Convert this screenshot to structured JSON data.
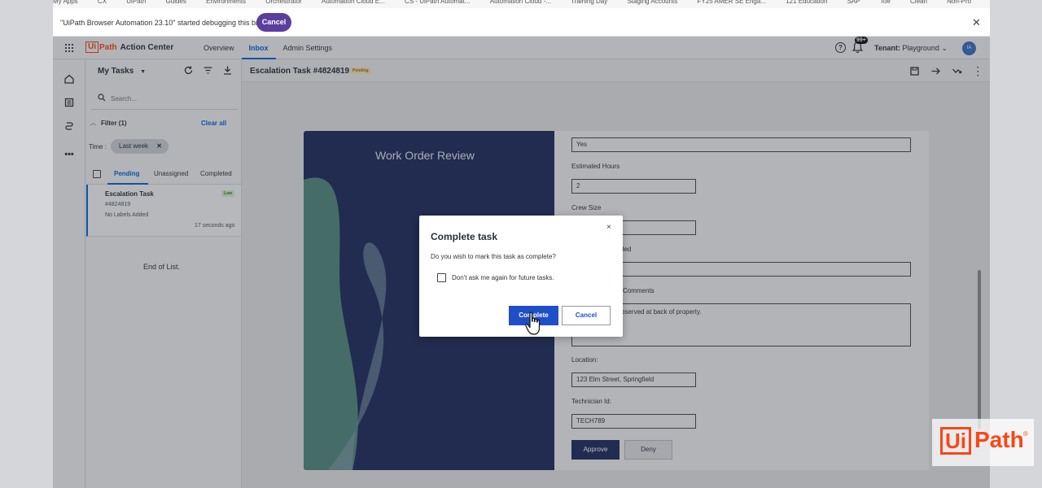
{
  "bookmarks": [
    "My Apps",
    "CX",
    "UiPath",
    "Guides",
    "Environments",
    "Orchestrator",
    "Automation Cloud E...",
    "CS - UiPath Automat...",
    "Automation Cloud -...",
    "Training Day",
    "Staging Accounts",
    "FY25 AMER SE Enga...",
    "121 Education",
    "SAP",
    "Toe",
    "Clean",
    "Non-Pro"
  ],
  "debug_bar": {
    "message": "\"UiPath Browser Automation 23.10\" started debugging this browser",
    "cancel_label": "Cancel",
    "close_glyph": "✕"
  },
  "header": {
    "logo_box": "Ui",
    "logo_path": "Path",
    "product": "Action Center",
    "nav": [
      "Overview",
      "Inbox",
      "Admin Settings"
    ],
    "active_nav": "Inbox",
    "notification_count": "99+",
    "tenant_label": "Tenant:",
    "tenant_value": "Playground",
    "avatar_initials": "IA"
  },
  "task_panel": {
    "title": "My Tasks",
    "search_placeholder": "Search...",
    "filter_label": "Filter (1)",
    "clear_all": "Clear all",
    "time_label": "Time :",
    "chip_label": "Last week",
    "chip_close": "✕",
    "tabs": [
      "Pending",
      "Unassigned",
      "Completed"
    ],
    "task": {
      "title": "Escalation Task",
      "id": "#4824819",
      "labels": "No Labels Added",
      "priority": "Low",
      "time": "17 seconds ago"
    },
    "end_of_list": "End of List."
  },
  "main": {
    "task_title": "Escalation Task #4824819",
    "status_badge": "Pending",
    "form_title": "Work Order Review",
    "fields": {
      "top_value": "Yes",
      "estimated_hours_label": "Estimated Hours",
      "estimated_hours_value": "2",
      "crew_size_label": "Crew Size",
      "field3_label_tail": "ded",
      "comments_label_tail": "Comments",
      "comments_value_tail": "bserved at back of property.",
      "location_label": "Location:",
      "location_value": "123 Elm Street, Springfield",
      "technician_label": "Technician Id:",
      "technician_value": "TECH789"
    },
    "approve_label": "Approve",
    "deny_label": "Deny"
  },
  "modal": {
    "title": "Complete task",
    "message": "Do you wish to mark this task as complete?",
    "checkbox_label": "Don't ask me again for future tasks.",
    "complete_label": "Complete",
    "cancel_label": "Cancel",
    "close_glyph": "×"
  },
  "watermark": {
    "box": "Ui",
    "path": "Path",
    "mark": "®"
  },
  "colors": {
    "brand_orange": "#fa4616",
    "primary_blue": "#1f4fc6",
    "navy": "#1e2d5e",
    "debug_purple": "#5c3e9e"
  }
}
